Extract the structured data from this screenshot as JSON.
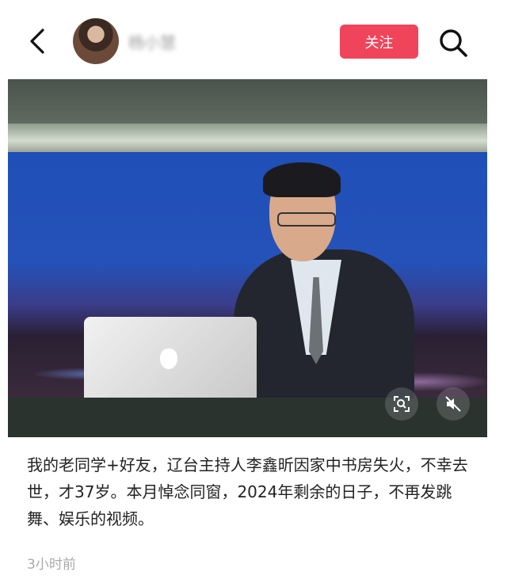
{
  "header": {
    "username": "杨小慧",
    "follow_label": "关注"
  },
  "icons": {
    "back": "back-icon",
    "avatar": "avatar",
    "search": "search-icon",
    "scan": "scan-icon",
    "mute": "mute-icon"
  },
  "post": {
    "caption": "我的老同学+好友，辽台主持人李鑫昕因家中书房失火，不幸去世，才37岁。本月悼念同窗，2024年剩余的日子，不再发跳舞、娱乐的视频。",
    "timestamp": "3小时前"
  },
  "colors": {
    "follow_button": "#f0445a",
    "studio_blue": "#2452b8"
  }
}
